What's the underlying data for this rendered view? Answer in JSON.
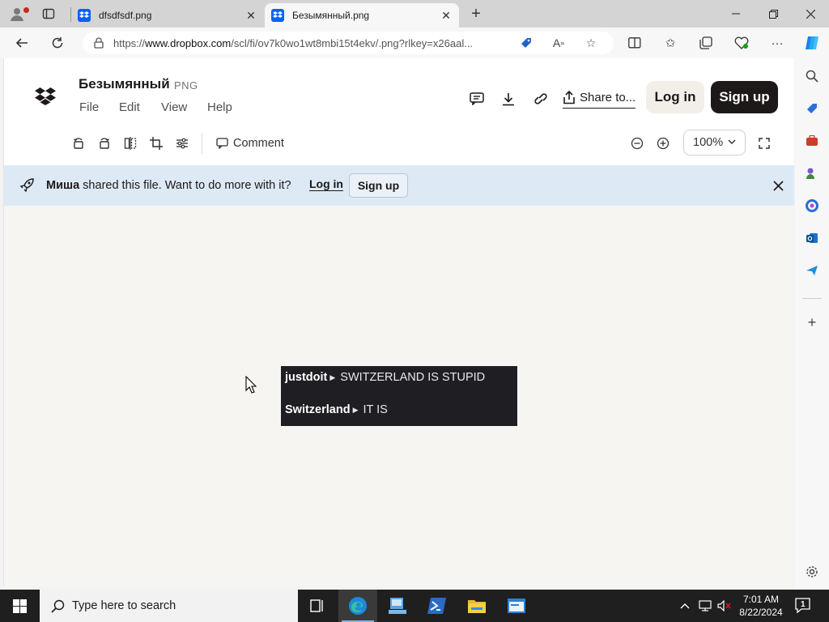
{
  "browser": {
    "tabs": [
      {
        "title": "dfsdfsdf.png",
        "close": "✕"
      },
      {
        "title": "Безымянный.png",
        "close": "✕"
      }
    ],
    "new_tab": "+",
    "url_prefix": "https://",
    "url_host": "www.dropbox.com",
    "url_rest": "/scl/fi/ov7k0wo1wt8mbi15t4ekv/.png?rlkey=x26aal..."
  },
  "header": {
    "file_name": "Безымянный",
    "file_ext": "PNG",
    "menu": [
      "File",
      "Edit",
      "View",
      "Help"
    ],
    "share_label": "Share to...",
    "login_label": "Log in",
    "signup_label": "Sign up"
  },
  "toolbar": {
    "comment_label": "Comment",
    "zoom_value": "100%"
  },
  "banner": {
    "user": "Миша",
    "message": " shared this file. Want to do more with it?",
    "login_label": "Log in",
    "signup_label": "Sign up"
  },
  "preview": {
    "lines": [
      {
        "user": "justdoit",
        "text": "SWITZERLAND IS STUPID"
      },
      {
        "user": "Switzerland",
        "text": "IT IS"
      }
    ]
  },
  "taskbar": {
    "search_placeholder": "Type here to search",
    "time": "7:01 AM",
    "date": "8/22/2024",
    "notifications": "1"
  },
  "colors": {
    "dropbox_blue": "#0061fe",
    "banner_bg": "#ddeaf6",
    "signup_bg": "#1e1919",
    "login_bg": "#f2efe9",
    "preview_bg": "#1f1f23"
  }
}
